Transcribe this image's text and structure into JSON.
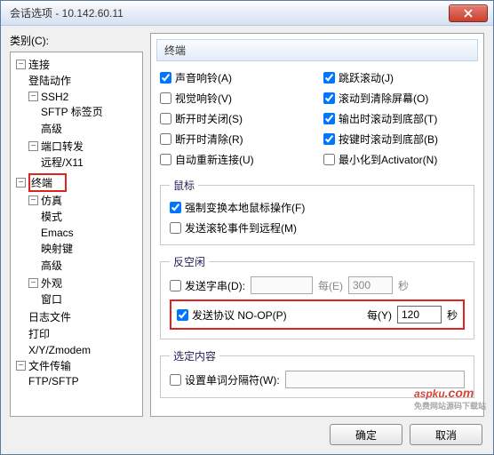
{
  "window": {
    "title": "会话选项 - 10.142.60.11"
  },
  "category_label": "类别(C):",
  "tree": {
    "conn": "连接",
    "login": "登陆动作",
    "ssh2": "SSH2",
    "sftp_tab": "SFTP 标签页",
    "advanced1": "高级",
    "port_fwd": "端口转发",
    "remote_x11": "远程/X11",
    "terminal": "终端",
    "emulation": "仿真",
    "mode": "模式",
    "emacs": "Emacs",
    "map_keys": "映射键",
    "advanced2": "高级",
    "appearance": "外观",
    "window": "窗口",
    "log": "日志文件",
    "print": "打印",
    "xyz": "X/Y/Zmodem",
    "file_transfer": "文件传输",
    "ftp_sftp": "FTP/SFTP"
  },
  "panel_header": "终端",
  "checks": {
    "audio_bell": "声音响铃(A)",
    "jump_scroll": "跳跃滚动(J)",
    "visual_bell": "视觉响铃(V)",
    "scroll_clear": "滚动到清除屏幕(O)",
    "close_disconn": "断开时关闭(S)",
    "scroll_output": "输出时滚动到底部(T)",
    "clear_disconn": "断开时清除(R)",
    "scroll_key": "按键时滚动到底部(B)",
    "auto_reconn": "自动重新连接(U)",
    "min_activator": "最小化到Activator(N)"
  },
  "mouse": {
    "legend": "鼠标",
    "force_local": "强制变换本地鼠标操作(F)",
    "send_wheel": "发送滚轮事件到远程(M)"
  },
  "antiidle": {
    "legend": "反空闲",
    "send_string": "发送字串(D):",
    "every1_label": "每(E)",
    "every1_value": "300",
    "unit": "秒",
    "send_noop": "发送协议 NO-OP(P)",
    "every2_label": "每(Y)",
    "every2_value": "120"
  },
  "selection": {
    "legend": "选定内容",
    "word_delim": "设置单词分隔符(W):"
  },
  "buttons": {
    "ok": "确定",
    "cancel": "取消"
  },
  "watermark": {
    "main": "aspku",
    "sub": "免费网站源码下载站",
    "dot": ".com"
  }
}
